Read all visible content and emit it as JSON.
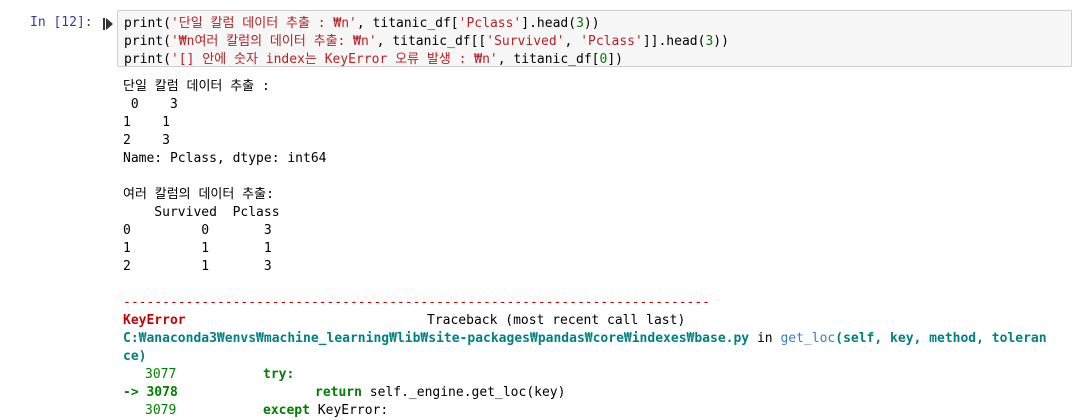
{
  "cell": {
    "prompt": "In [12]:",
    "code": [
      {
        "pre": "print(",
        "str": "'단일 칼럼 데이터 추출 : ₩n'",
        "mid": ", titanic_df[",
        "str2": "'Pclass'",
        "post": "].head(",
        "num": "3",
        "end": "))"
      },
      {
        "pre": "print(",
        "str": "'₩n여러 칼럼의 데이터 추출: ₩n'",
        "mid": ", titanic_df[[",
        "str2": "'Survived'",
        "sep": ", ",
        "str3": "'Pclass'",
        "post": "]].head(",
        "num": "3",
        "end": "))"
      },
      {
        "pre": "print(",
        "str": "'[] 안에 숫자 index는 KeyError 오류 발생 : ₩n'",
        "mid": ", titanic_df[",
        "num": "0",
        "end": "])"
      }
    ]
  },
  "output": {
    "lines1": [
      "단일 칼럼 데이터 추출 :",
      " 0    3",
      "1    1",
      "2    3",
      "Name: Pclass, dtype: int64"
    ],
    "lines2": [
      "여러 칼럼의 데이터 추출:",
      "    Survived  Pclass",
      "0         0       3",
      "1         1       1",
      "2         1       3"
    ],
    "traceback": {
      "separator": "---------------------------------------------------------------------------",
      "error_name": "KeyError",
      "header": "Traceback (most recent call last)",
      "path": "C:₩anaconda3₩envs₩machine_learning₩lib₩site-packages₩pandas₩core₩indexes₩base.py",
      "in_word": " in ",
      "func": "get_loc",
      "args1": "(self, key, method, toleran",
      "args2": "ce)",
      "rows": [
        {
          "num": "3077",
          "marker": "",
          "kw": "try:",
          "code": ""
        },
        {
          "num": "3078",
          "marker": "-> ",
          "kw": "return",
          "code": " self._engine.get_loc(key)"
        },
        {
          "num": "3079",
          "marker": "",
          "kw": "except",
          "code": " KeyError:"
        }
      ]
    }
  }
}
